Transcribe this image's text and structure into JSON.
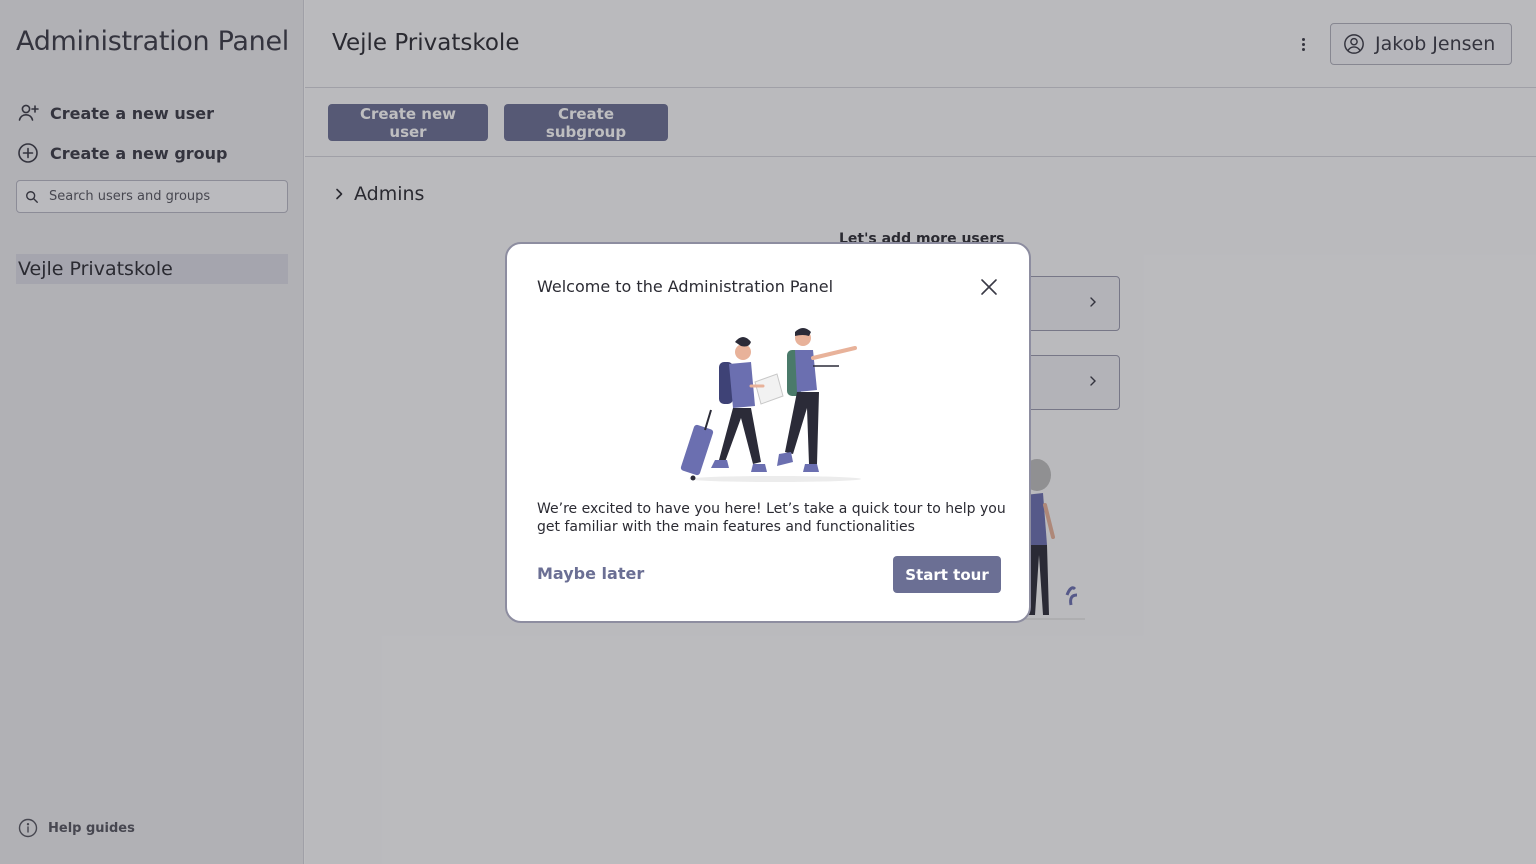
{
  "sidebar": {
    "app_title": "Administration Panel",
    "create_user_label": "Create a new user",
    "create_group_label": "Create a new group",
    "search_placeholder": "Search users and groups",
    "tree_items": [
      "Vejle Privatskole"
    ],
    "help_label": "Help guides"
  },
  "header": {
    "title": "Vejle Privatskole",
    "user_name": "Jakob Jensen"
  },
  "toolbar": {
    "create_user_label": "Create new user",
    "create_subgroup_label": "Create subgroup"
  },
  "content": {
    "group_name": "Admins",
    "background_heading": "Let's add more users"
  },
  "modal": {
    "title": "Welcome to the Administration Panel",
    "body": "We’re excited to have you here! Let’s take a quick tour to help you get familiar with the main features and functionalities",
    "secondary_label": "Maybe later",
    "primary_label": "Start tour"
  },
  "colors": {
    "accent": "#6b6f94",
    "illustration_purple": "#6b6fb0",
    "sidebar_bg": "#ececf0"
  },
  "icons": [
    "add-user-icon",
    "add-circle-icon",
    "search-icon",
    "info-icon",
    "more-vertical-icon",
    "user-circle-icon",
    "chevron-right-icon",
    "close-icon"
  ]
}
